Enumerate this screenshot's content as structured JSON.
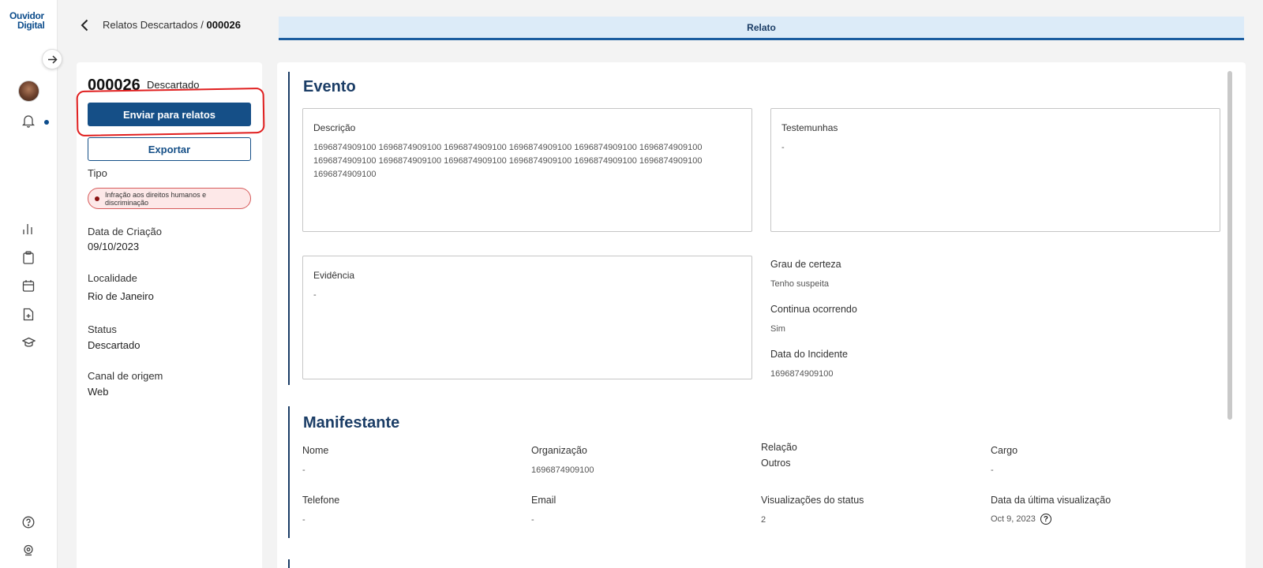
{
  "app": {
    "logo_line1": "Ouvidor",
    "logo_line2": "Digital"
  },
  "breadcrumb": {
    "parent": "Relatos Descartados",
    "separator": "/",
    "current": "000026"
  },
  "tab": {
    "label": "Relato"
  },
  "record": {
    "id": "000026",
    "state": "Descartado",
    "primary_button": "Enviar para relatos",
    "secondary_button": "Exportar",
    "fields": {
      "tipo_label": "Tipo",
      "tipo_value": "Infração aos direitos humanos e discriminação",
      "data_label": "Data de Criação",
      "data_value": "09/10/2023",
      "localidade_label": "Localidade",
      "localidade_value": "Rio de Janeiro",
      "status_label": "Status",
      "status_value": "Descartado",
      "canal_label": "Canal de origem",
      "canal_value": "Web"
    }
  },
  "evento": {
    "title": "Evento",
    "descricao_label": "Descrição",
    "descricao_value": "1696874909100 1696874909100 1696874909100 1696874909100 1696874909100 1696874909100 1696874909100 1696874909100 1696874909100 1696874909100 1696874909100 1696874909100 1696874909100",
    "testemunhas_label": "Testemunhas",
    "testemunhas_value": "-",
    "evidencia_label": "Evidência",
    "evidencia_value": "-",
    "grau_label": "Grau de certeza",
    "grau_value": "Tenho suspeita",
    "continua_label": "Continua ocorrendo",
    "continua_value": "Sim",
    "data_incidente_label": "Data do Incidente",
    "data_incidente_value": "1696874909100"
  },
  "manifestante": {
    "title": "Manifestante",
    "nome_label": "Nome",
    "nome_value": "-",
    "organizacao_label": "Organização",
    "organizacao_value": "1696874909100",
    "relacao_label": "Relação",
    "relacao_value": "Outros",
    "cargo_label": "Cargo",
    "cargo_value": "-",
    "telefone_label": "Telefone",
    "telefone_value": "-",
    "email_label": "Email",
    "email_value": "-",
    "visualizacoes_label": "Visualizações do status",
    "visualizacoes_value": "2",
    "ultima_label": "Data da última visualização",
    "ultima_value": "Oct 9, 2023"
  },
  "colors": {
    "primary": "#154f87",
    "title": "#1b3d66",
    "highlight": "#e01f1f",
    "tag_bg": "#fde8e8"
  }
}
